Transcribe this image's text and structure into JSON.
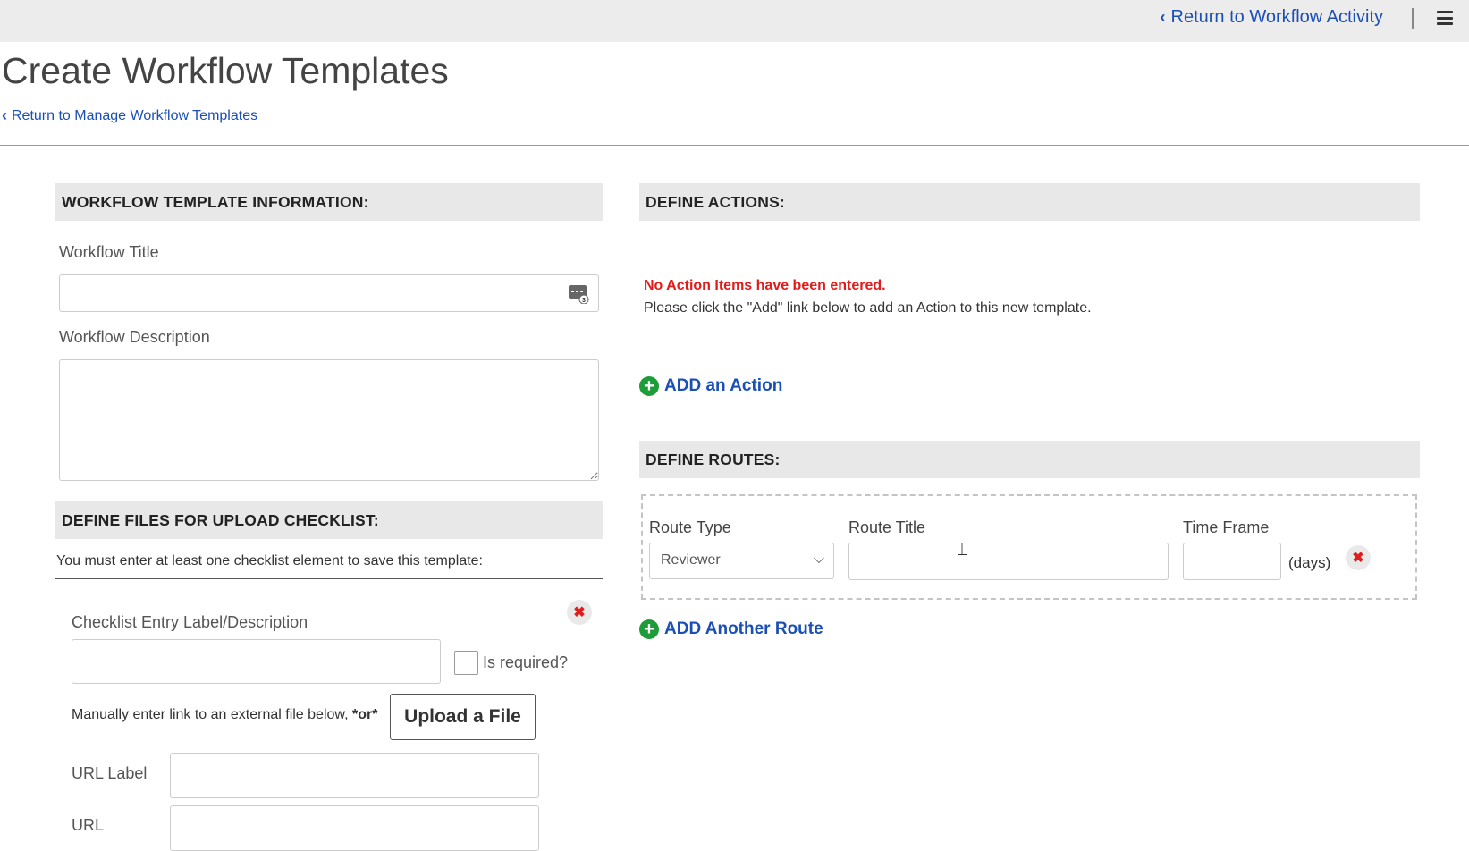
{
  "topbar": {
    "return_activity": "Return to Workflow Activity",
    "menu_icon": "hamburger-icon"
  },
  "header": {
    "title": "Create Workflow Templates",
    "back_link": "Return to Manage Workflow Templates"
  },
  "template_info": {
    "heading": "WORKFLOW TEMPLATE INFORMATION:",
    "title_label": "Workflow Title",
    "title_value": "",
    "description_label": "Workflow Description",
    "description_value": ""
  },
  "files": {
    "heading": "DEFINE FILES FOR UPLOAD CHECKLIST:",
    "instruction": "You must enter at least one checklist element to save this template:",
    "entry_label": "Checklist Entry Label/Description",
    "entry_value": "",
    "required_label": "Is required?",
    "manual_text": "Manually enter link to an external file below,",
    "manual_or": "*or*",
    "upload_button": "Upload a File",
    "url_label_label": "URL Label",
    "url_label_value": "",
    "url_label": "URL",
    "url_value": ""
  },
  "actions": {
    "heading": "DEFINE ACTIONS:",
    "empty_title": "No Action Items have been entered.",
    "empty_sub": "Please click the \"Add\" link below to add an Action to this new template.",
    "add_label": "ADD an Action"
  },
  "routes": {
    "heading": "DEFINE ROUTES:",
    "type_label": "Route Type",
    "type_value": "Reviewer",
    "title_label": "Route Title",
    "title_value": "",
    "timeframe_label": "Time Frame",
    "timeframe_value": "",
    "days_label": "(days)",
    "add_label": "ADD Another Route"
  },
  "colors": {
    "link": "#1a4fb5",
    "error": "#e21b1b",
    "add_icon": "#1f9c3a",
    "section_bg": "#e8e8e8"
  }
}
